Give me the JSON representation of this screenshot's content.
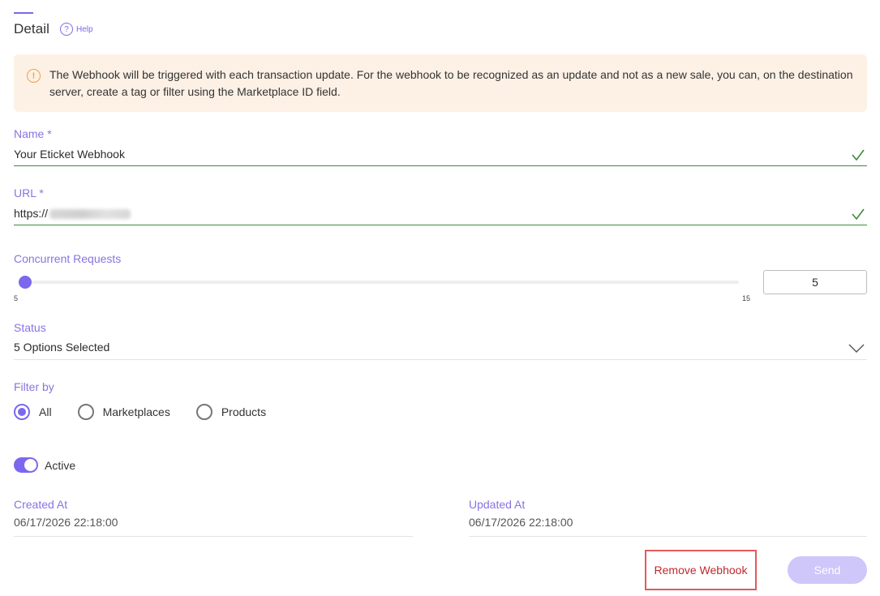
{
  "header": {
    "title": "Detail",
    "help_label": "Help",
    "help_icon": "question-circle-icon"
  },
  "alert": {
    "icon": "warning-circle-icon",
    "text": "The Webhook will be triggered with each transaction update. For the webhook to be recognized as an update and not as a new sale, you can, on the destination server, create a tag or filter using the Marketplace ID field."
  },
  "form": {
    "name": {
      "label": "Name *",
      "value": "Your Eticket Webhook",
      "valid": true
    },
    "url": {
      "label": "URL *",
      "value": "https://",
      "valid": true
    },
    "concurrent": {
      "label": "Concurrent Requests",
      "min": "5",
      "max": "15",
      "value": "5",
      "slider_level": 0
    },
    "status": {
      "label": "Status",
      "value": "5 Options Selected"
    },
    "filter_by": {
      "label": "Filter by",
      "options": [
        {
          "label": "All",
          "checked": true
        },
        {
          "label": "Marketplaces",
          "checked": false
        },
        {
          "label": "Products",
          "checked": false
        }
      ]
    },
    "active": {
      "label": "Active",
      "on": true
    },
    "created_at": {
      "label": "Created At",
      "value": "06/17/2026 22:18:00"
    },
    "updated_at": {
      "label": "Updated At",
      "value": "06/17/2026 22:18:00"
    }
  },
  "actions": {
    "remove_label": "Remove Webhook",
    "send_label": "Send"
  },
  "colors": {
    "accent": "#7b68ee",
    "valid": "#3a8a3a",
    "alert_bg": "#fdf1e6",
    "danger": "#c0282d",
    "send_disabled": "#cfc6fa"
  }
}
